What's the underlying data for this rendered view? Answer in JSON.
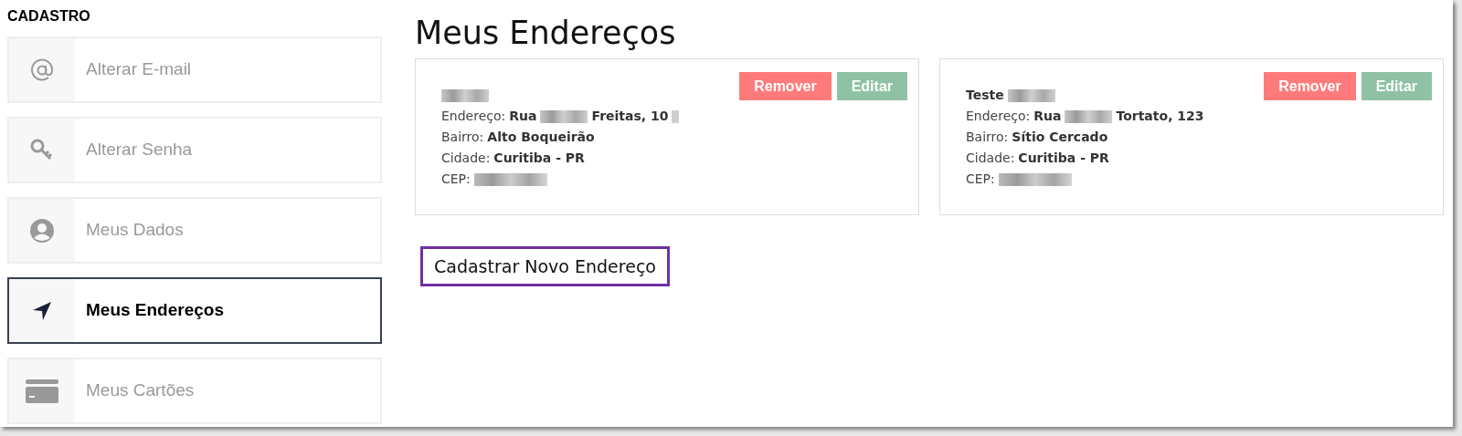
{
  "sidebar": {
    "heading": "CADASTRO",
    "items": [
      {
        "label": "Alterar E-mail",
        "kind": "at",
        "selected": false
      },
      {
        "label": "Alterar Senha",
        "kind": "key",
        "selected": false
      },
      {
        "label": "Meus Dados",
        "kind": "user",
        "selected": false
      },
      {
        "label": "Meus Endereços",
        "kind": "location",
        "selected": true
      },
      {
        "label": "Meus Cartões",
        "kind": "card",
        "selected": false
      }
    ]
  },
  "page_title": "Meus Endereços",
  "addresses": [
    {
      "name": [
        {
          "kind": "redacted"
        }
      ],
      "buttons": [
        {
          "label": "Remover",
          "kind": "danger"
        },
        {
          "label": "Editar",
          "kind": "edit"
        }
      ],
      "lines": [
        {
          "label": "Endereço:",
          "parts": [
            {
              "kind": "text",
              "text": "Rua"
            },
            {
              "kind": "redacted"
            },
            {
              "kind": "text",
              "text": "Freitas, 10"
            },
            {
              "kind": "redacted_short"
            }
          ]
        },
        {
          "label": "Bairro:",
          "parts": [
            {
              "kind": "text",
              "text": "Alto Boqueirão"
            }
          ]
        },
        {
          "label": "Cidade:",
          "parts": [
            {
              "kind": "text",
              "text": "Curitiba - PR"
            }
          ]
        },
        {
          "label": "CEP:",
          "parts": [
            {
              "kind": "redacted_long"
            }
          ]
        }
      ]
    },
    {
      "name": [
        {
          "kind": "text",
          "text": "Teste"
        },
        {
          "kind": "redacted"
        }
      ],
      "buttons": [
        {
          "label": "Remover",
          "kind": "danger"
        },
        {
          "label": "Editar",
          "kind": "edit"
        }
      ],
      "lines": [
        {
          "label": "Endereço:",
          "parts": [
            {
              "kind": "text",
              "text": "Rua"
            },
            {
              "kind": "redacted"
            },
            {
              "kind": "text",
              "text": "Tortato, 123"
            }
          ]
        },
        {
          "label": "Bairro:",
          "parts": [
            {
              "kind": "text",
              "text": "Sítio Cercado"
            }
          ]
        },
        {
          "label": "Cidade:",
          "parts": [
            {
              "kind": "text",
              "text": "Curitiba - PR"
            }
          ]
        },
        {
          "label": "CEP:",
          "parts": [
            {
              "kind": "redacted_long"
            }
          ]
        }
      ]
    }
  ],
  "new_address_button": "Cadastrar Novo Endereço"
}
